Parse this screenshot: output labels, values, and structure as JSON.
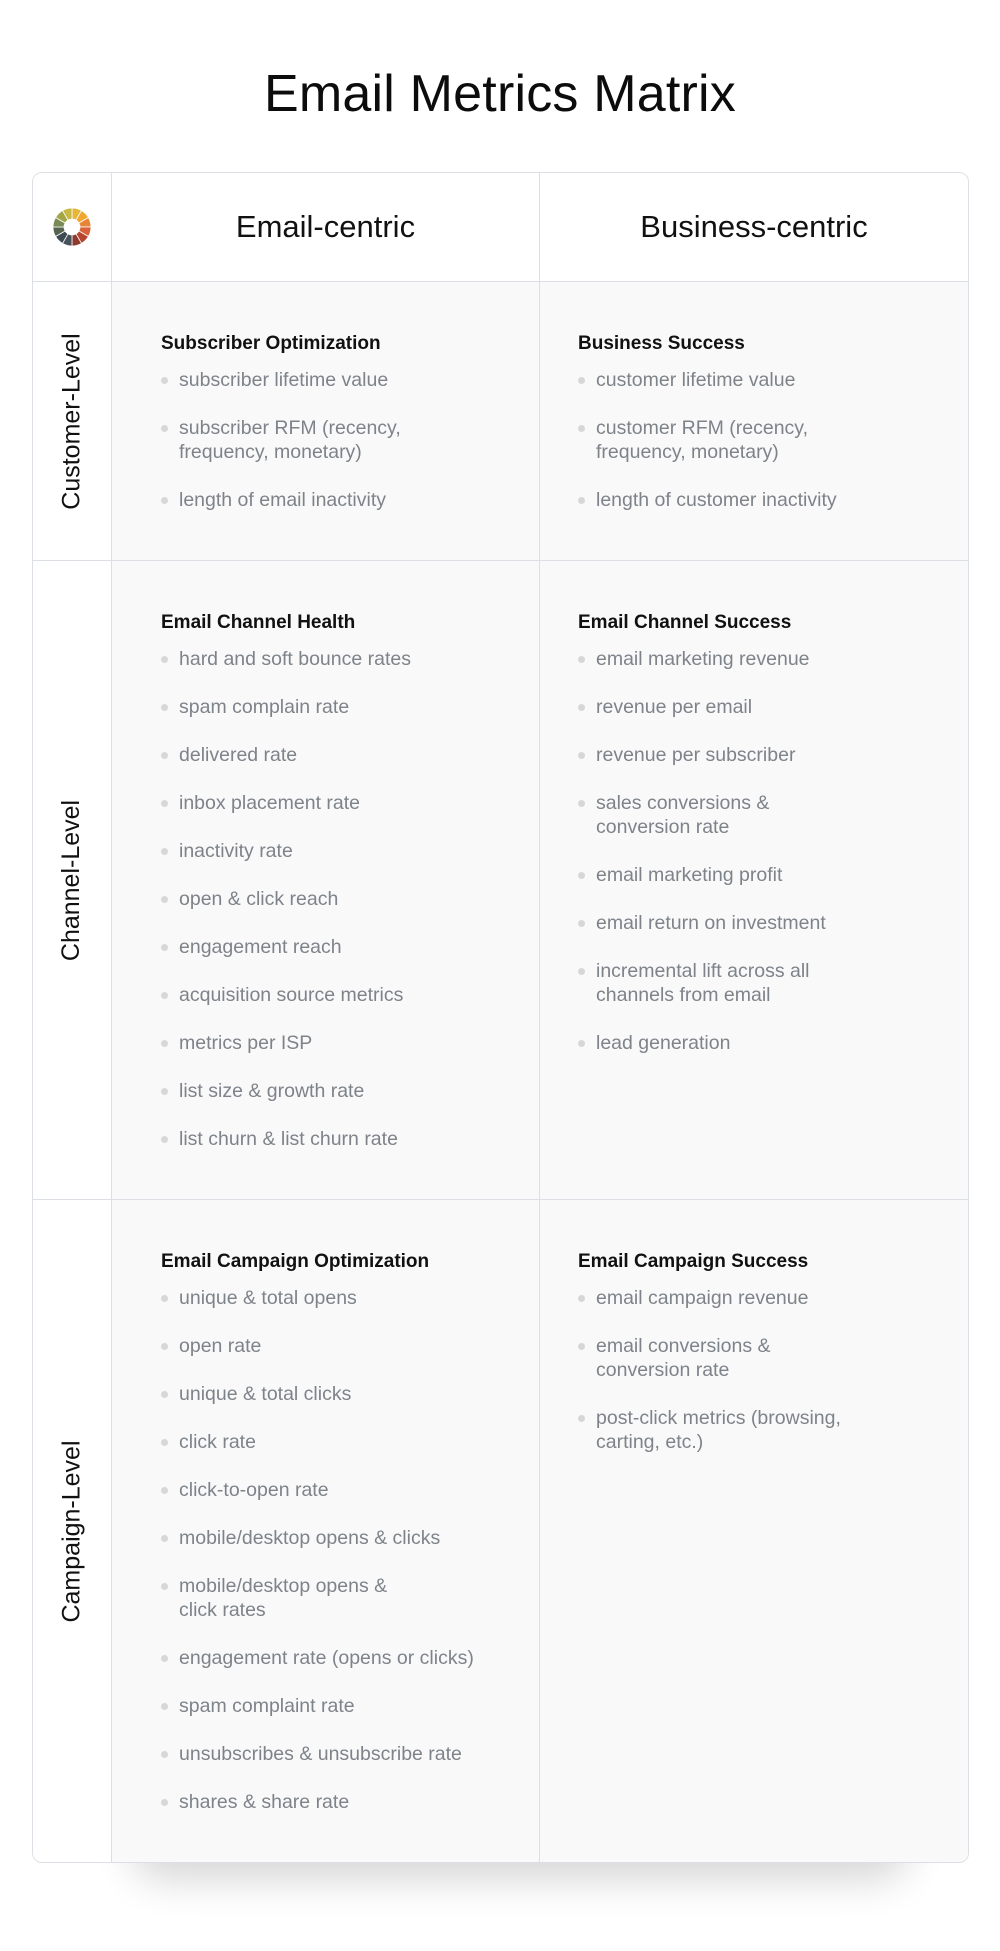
{
  "title": "Email Metrics Matrix",
  "logo": {
    "icon": "color-wheel-logo",
    "colors": [
      "#e4b73b",
      "#f0a830",
      "#e88638",
      "#d9623a",
      "#b8452f",
      "#8e3a2e",
      "#48525a",
      "#3f4b52",
      "#55634f",
      "#7a8a55",
      "#a3a546",
      "#c8b845"
    ]
  },
  "columns": [
    "Email-centric",
    "Business-centric"
  ],
  "rows": [
    {
      "label": "Customer-Level",
      "cells": [
        {
          "title": "Subscriber Optimization",
          "items": [
            "subscriber lifetime value",
            "subscriber RFM (recency,\nfrequency, monetary)",
            "length of email inactivity"
          ]
        },
        {
          "title": "Business Success",
          "items": [
            "customer lifetime value",
            "customer RFM (recency,\nfrequency, monetary)",
            "length of customer inactivity"
          ]
        }
      ]
    },
    {
      "label": "Channel-Level",
      "cells": [
        {
          "title": "Email Channel Health",
          "items": [
            "hard and soft bounce rates",
            "spam complain rate",
            "delivered rate",
            "inbox placement rate",
            "inactivity rate",
            "open & click reach",
            "engagement reach",
            "acquisition source metrics",
            "metrics per ISP",
            "list size & growth rate",
            "list churn & list churn rate"
          ]
        },
        {
          "title": "Email Channel Success",
          "items": [
            "email marketing revenue",
            "revenue per email",
            "revenue per subscriber",
            "sales conversions &\nconversion rate",
            "email marketing profit",
            "email return on investment",
            "incremental lift across all\nchannels from email",
            "lead generation"
          ]
        }
      ]
    },
    {
      "label": "Campaign-Level",
      "cells": [
        {
          "title": "Email Campaign Optimization",
          "items": [
            "unique & total opens",
            "open rate",
            "unique & total clicks",
            "click rate",
            "click-to-open rate",
            "mobile/desktop opens & clicks",
            "mobile/desktop opens &\nclick rates",
            "engagement rate (opens or clicks)",
            "spam complaint rate",
            "unsubscribes & unsubscribe rate",
            "shares & share rate"
          ]
        },
        {
          "title": "Email Campaign Success",
          "items": [
            "email campaign revenue",
            "email conversions &\nconversion rate",
            "post-click metrics (browsing,\ncarting, etc.)"
          ]
        }
      ]
    }
  ]
}
